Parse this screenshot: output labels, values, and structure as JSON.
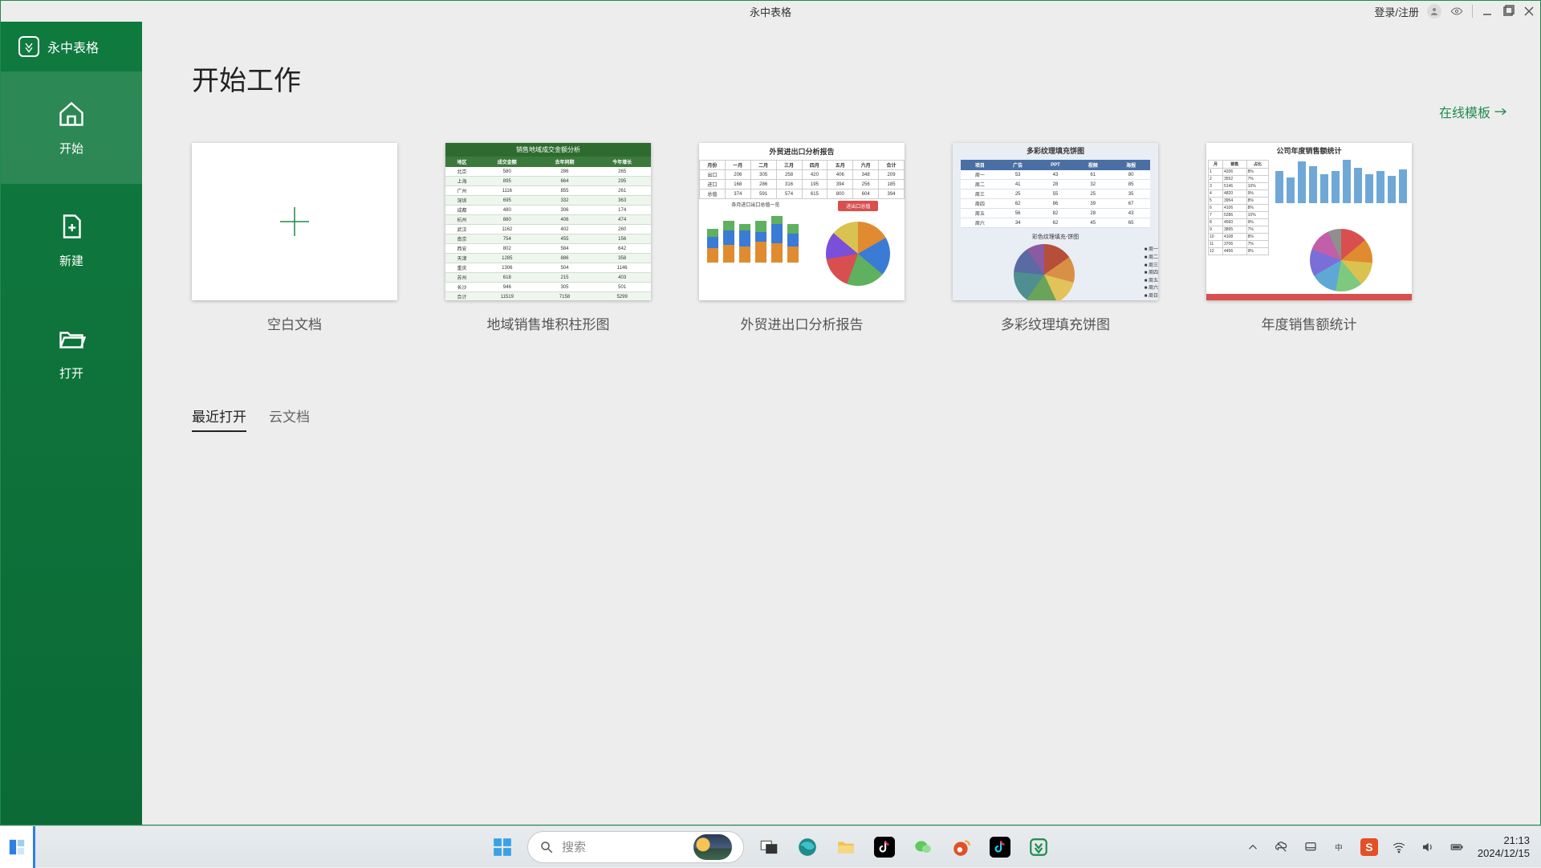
{
  "titlebar": {
    "app_title": "永中表格",
    "login_label": "登录/注册"
  },
  "sidebar": {
    "brand": "永中表格",
    "items": [
      {
        "label": "开始"
      },
      {
        "label": "新建"
      },
      {
        "label": "打开"
      }
    ]
  },
  "main": {
    "heading": "开始工作",
    "online_templates_label": "在线模板",
    "templates": [
      {
        "caption": "空白文档"
      },
      {
        "caption": "地域销售堆积柱形图"
      },
      {
        "caption": "外贸进出口分析报告"
      },
      {
        "caption": "多彩纹理填充饼图"
      },
      {
        "caption": "年度销售额统计"
      }
    ],
    "template_previews": {
      "t1_title": "销售地域成交金额分析",
      "t1_headers": [
        "地区",
        "成交金额",
        "去年同期",
        "今年增长"
      ],
      "t2_title": "外贸进出口分析报告",
      "t2_sub_left": "各月进口出口总值一览",
      "t2_sub_right": "进出口总值",
      "t3_title": "多彩纹理填充饼图",
      "t3_headers": [
        "项目",
        "广告",
        "PPT",
        "视频",
        "海报"
      ],
      "t3_sub": "彩色纹理填充-饼图",
      "t4_title": "公司年度销售额统计"
    },
    "tabs": [
      {
        "label": "最近打开"
      },
      {
        "label": "云文档"
      }
    ]
  },
  "taskbar": {
    "search_placeholder": "搜索",
    "clock_time": "21:13",
    "clock_date": "2024/12/15"
  }
}
